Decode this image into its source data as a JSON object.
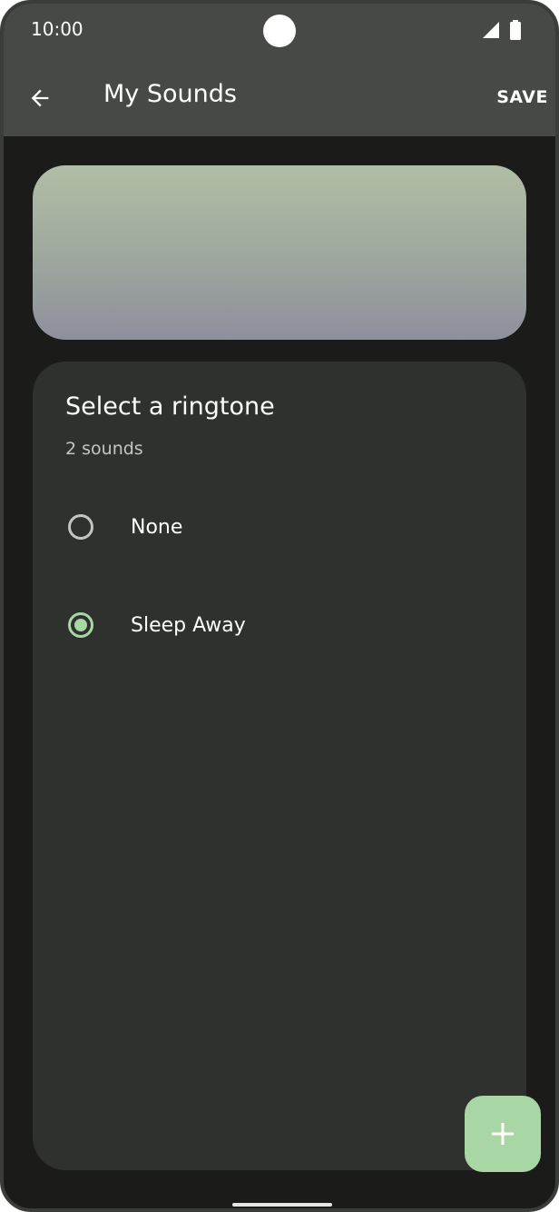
{
  "status_bar": {
    "time": "10:00",
    "icons": [
      "camera-cutout",
      "cellular-signal-icon",
      "battery-icon"
    ]
  },
  "app_bar": {
    "back_icon": "arrow-left-icon",
    "title": "My Sounds",
    "save_label": "SAVE"
  },
  "card": {
    "title": "Select a ringtone",
    "subtitle": "2 sounds",
    "options": [
      {
        "label": "None",
        "selected": false
      },
      {
        "label": "Sleep Away",
        "selected": true
      }
    ]
  },
  "fab": {
    "icon": "plus-icon"
  },
  "colors": {
    "accent": "#a8d7a5",
    "app_bar": "#474946",
    "card_background": "#2f312e",
    "screen_background": "#1b1c1a",
    "radio_unselected": "#c4c6c0"
  }
}
